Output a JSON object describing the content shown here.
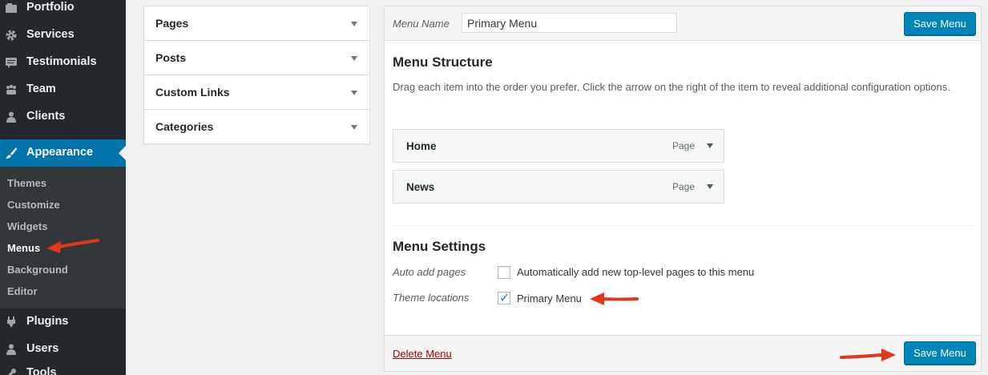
{
  "sidebar": {
    "items": [
      {
        "label": "Portfolio",
        "icon": "portfolio-icon"
      },
      {
        "label": "Services",
        "icon": "gear-icon"
      },
      {
        "label": "Testimonials",
        "icon": "testimonial-icon"
      },
      {
        "label": "Team",
        "icon": "team-icon"
      },
      {
        "label": "Clients",
        "icon": "clients-icon"
      },
      {
        "label": "Appearance",
        "icon": "brush-icon"
      },
      {
        "label": "Plugins",
        "icon": "plugin-icon"
      },
      {
        "label": "Users",
        "icon": "user-icon"
      },
      {
        "label": "Tools",
        "icon": "tools-icon"
      }
    ],
    "submenu": [
      "Themes",
      "Customize",
      "Widgets",
      "Menus",
      "Background",
      "Editor"
    ],
    "active_item": "Appearance",
    "current_submenu": "Menus"
  },
  "accordion": {
    "sections": [
      "Pages",
      "Posts",
      "Custom Links",
      "Categories"
    ]
  },
  "editor": {
    "menu_name_label": "Menu Name",
    "menu_name_value": "Primary Menu",
    "save_label": "Save Menu",
    "structure_title": "Menu Structure",
    "structure_desc": "Drag each item into the order you prefer. Click the arrow on the right of the item to reveal additional configuration options.",
    "items": [
      {
        "title": "Home",
        "type": "Page"
      },
      {
        "title": "News",
        "type": "Page"
      }
    ],
    "settings_title": "Menu Settings",
    "auto_add_label": "Auto add pages",
    "auto_add_text": "Automatically add new top-level pages to this menu",
    "auto_add_checked": false,
    "theme_locations_label": "Theme locations",
    "primary_menu_text": "Primary Menu",
    "primary_menu_checked": true,
    "delete_label": "Delete Menu"
  },
  "colors": {
    "sidebar_bg": "#23282d",
    "active_bg": "#0073aa",
    "button_blue": "#0085ba",
    "annotation_red": "#e2371c",
    "delete_red": "#aa0000"
  }
}
